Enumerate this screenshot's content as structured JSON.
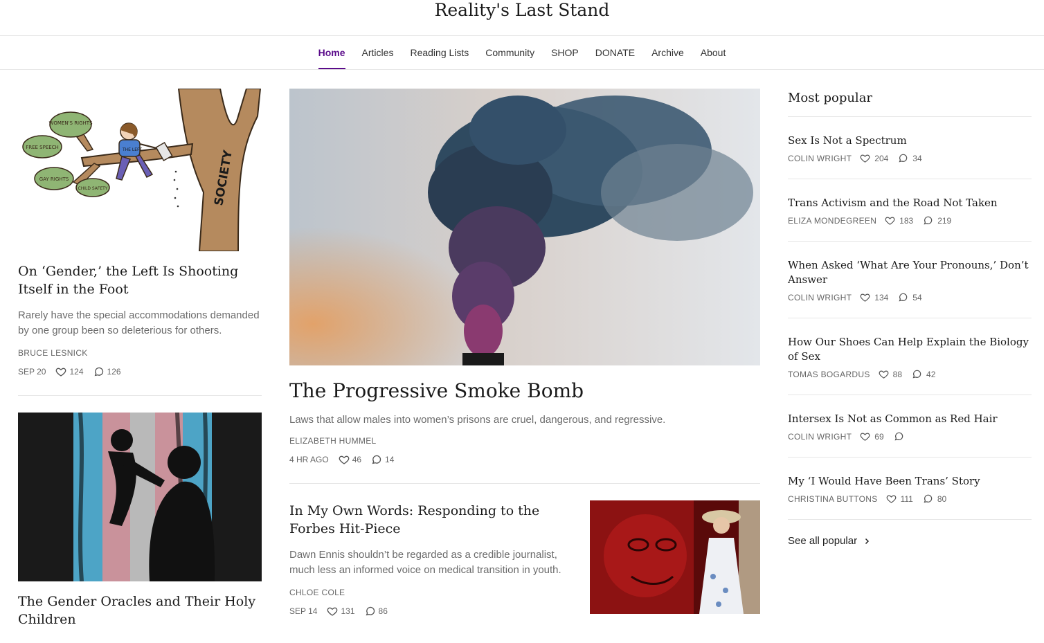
{
  "site": {
    "title": "Reality's Last Stand"
  },
  "nav": [
    "Home",
    "Articles",
    "Reading Lists",
    "Community",
    "SHOP",
    "DONATE",
    "Archive",
    "About"
  ],
  "left": [
    {
      "title": "On ‘Gender,’ the Left Is Shooting Itself in the Foot",
      "subtitle": "Rarely have the special accommodations demanded by one group been so deleterious for others.",
      "author": "BRUCE LESNICK",
      "date": "SEP 20",
      "likes": "124",
      "comments": "126",
      "illustration_labels": {
        "womens_rights": "WOMEN'S RIGHTS",
        "free_speech": "FREE SPEECH",
        "gay_rights": "GAY RIGHTS",
        "child_safety": "CHILD SAFETY",
        "the_left": "THE LEFT",
        "society": "SOCIETY"
      }
    },
    {
      "title": "The Gender Oracles and Their Holy Children"
    }
  ],
  "featured": {
    "title": "The Progressive Smoke Bomb",
    "subtitle": "Laws that allow males into women’s prisons are cruel, dangerous, and regressive.",
    "author": "ELIZABETH HUMMEL",
    "date": "4 HR AGO",
    "likes": "46",
    "comments": "14"
  },
  "second": {
    "title": "In My Own Words: Responding to the Forbes Hit-Piece",
    "subtitle": "Dawn Ennis shouldn’t be regarded as a credible journalist, much less an informed voice on medical transition in youth.",
    "author": "CHLOE COLE",
    "date": "SEP 14",
    "likes": "131",
    "comments": "86"
  },
  "popular": {
    "heading": "Most popular",
    "items": [
      {
        "title": "Sex Is Not a Spectrum",
        "author": "COLIN WRIGHT",
        "likes": "204",
        "comments": "34"
      },
      {
        "title": "Trans Activism and the Road Not Taken",
        "author": "ELIZA MONDEGREEN",
        "likes": "183",
        "comments": "219"
      },
      {
        "title": "When Asked ‘What Are Your Pronouns,’ Don’t Answer",
        "author": "COLIN WRIGHT",
        "likes": "134",
        "comments": "54"
      },
      {
        "title": "How Our Shoes Can Help Explain the Biology of Sex",
        "author": "TOMAS BOGARDUS",
        "likes": "88",
        "comments": "42"
      },
      {
        "title": "Intersex Is Not as Common as Red Hair",
        "author": "COLIN WRIGHT",
        "likes": "69",
        "comments": ""
      },
      {
        "title": "My ‘I Would Have Been Trans’ Story",
        "author": "CHRISTINA BUTTONS",
        "likes": "111",
        "comments": "80"
      }
    ],
    "see_all": "See all popular"
  },
  "colors": {
    "accent": "#5a0b8a"
  }
}
